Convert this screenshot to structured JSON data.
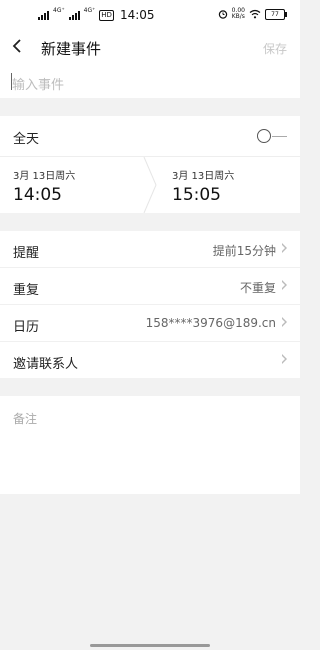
{
  "status_bar": {
    "sim1_label": "4G⁺",
    "sim2_label": "4G⁺",
    "hd_label": "HD",
    "time": "14:05",
    "speed_value": "0.00",
    "speed_unit": "KB/s",
    "battery": "77",
    "icons": [
      "signal-icon",
      "alarm-icon",
      "wifi-icon",
      "battery-icon"
    ]
  },
  "app_bar": {
    "title": "新建事件",
    "save_label": "保存",
    "save_enabled": false
  },
  "event": {
    "placeholder": "输入事件",
    "value": ""
  },
  "all_day": {
    "label": "全天",
    "on": false
  },
  "time_range": {
    "start_date": "3月 13日周六",
    "start_time": "14:05",
    "end_date": "3月 13日周六",
    "end_time": "15:05"
  },
  "settings": [
    {
      "label": "提醒",
      "value": "提前15分钟"
    },
    {
      "label": "重复",
      "value": "不重复"
    },
    {
      "label": "日历",
      "value": "158****3976@189.cn"
    },
    {
      "label": "邀请联系人",
      "value": ""
    }
  ],
  "notes": {
    "placeholder": "备注"
  },
  "colors": {
    "background": "#f2f2f2",
    "surface": "#ffffff",
    "disabled_text": "#c8c8c8"
  }
}
